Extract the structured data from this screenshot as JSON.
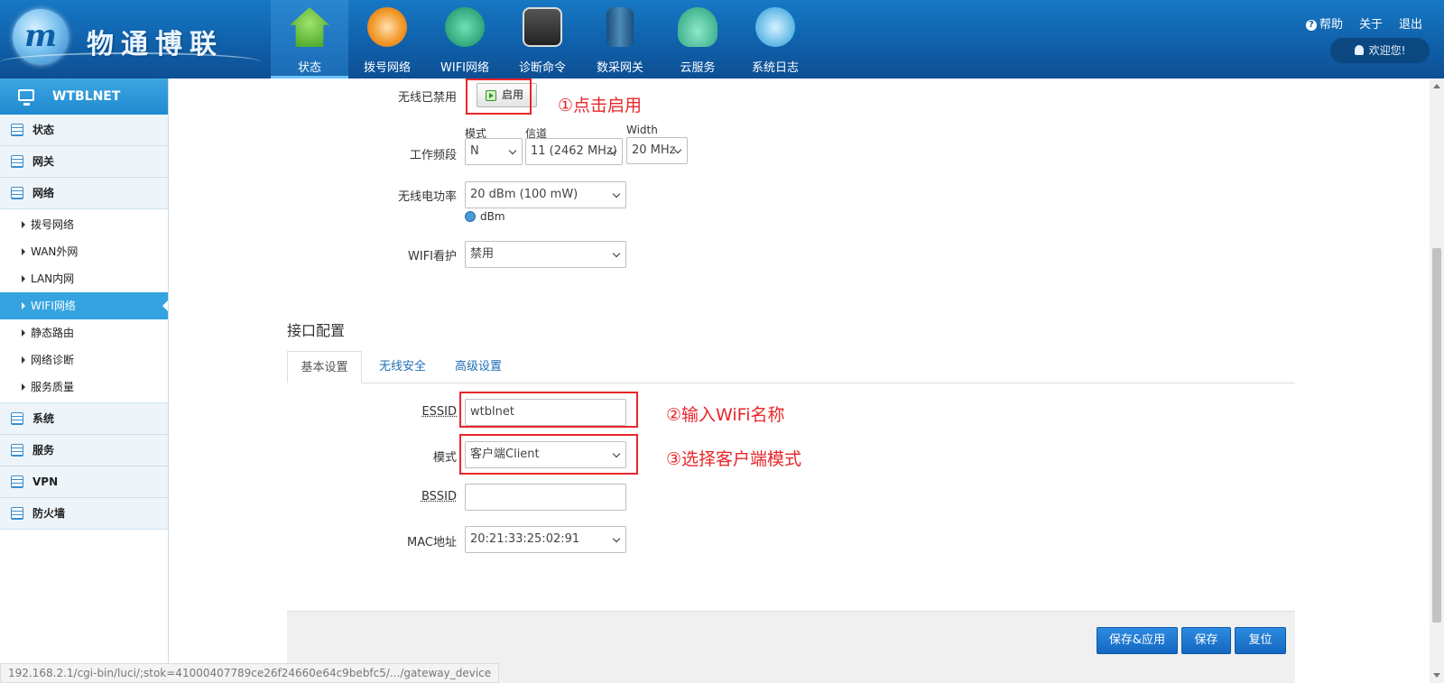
{
  "header": {
    "brand": "物通博联",
    "logo_letter": "m",
    "nav": [
      {
        "label": "状态",
        "icon": "home-icon",
        "active": true
      },
      {
        "label": "拨号网络",
        "icon": "dial-icon",
        "active": false
      },
      {
        "label": "WIFI网络",
        "icon": "wifi-icon",
        "active": false
      },
      {
        "label": "诊断命令",
        "icon": "terminal-icon",
        "active": false
      },
      {
        "label": "数采网关",
        "icon": "gateway-icon",
        "active": false
      },
      {
        "label": "云服务",
        "icon": "cloud-icon",
        "active": false
      },
      {
        "label": "系统日志",
        "icon": "stethoscope-icon",
        "active": false
      }
    ],
    "links": {
      "help": "帮助",
      "about": "关于",
      "logout": "退出"
    },
    "welcome": "欢迎您!"
  },
  "sidebar": {
    "title": "WTBLNET",
    "sections": [
      {
        "label": "状态"
      },
      {
        "label": "网关"
      },
      {
        "label": "网络"
      }
    ],
    "network_items": [
      "拨号网络",
      "WAN外网",
      "LAN内网",
      "WIFI网络",
      "静态路由",
      "网络诊断",
      "服务质量"
    ],
    "active_item": "WIFI网络",
    "sections_after": [
      {
        "label": "系统"
      },
      {
        "label": "服务"
      },
      {
        "label": "VPN"
      },
      {
        "label": "防火墙"
      }
    ]
  },
  "form": {
    "wireless_disabled_label": "无线已禁用",
    "enable_button": "启用",
    "band_label": "工作频段",
    "mode_caption": "模式",
    "channel_caption": "信道",
    "width_caption": "Width",
    "mode_value": "N",
    "channel_value": "11 (2462 MHz)",
    "width_value": "20 MHz",
    "power_label": "无线电功率",
    "power_value": "20 dBm (100 mW)",
    "power_unit": "dBm",
    "watchdog_label": "WIFI看护",
    "watchdog_value": "禁用",
    "interface_title": "接口配置",
    "tabs": [
      "基本设置",
      "无线安全",
      "高级设置"
    ],
    "essid_label": "ESSID",
    "essid_value": "wtblnet",
    "mode_label": "模式",
    "iface_mode_value": "客户端Client",
    "bssid_label": "BSSID",
    "bssid_value": "",
    "mac_label": "MAC地址",
    "mac_value": "20:21:33:25:02:91"
  },
  "annotations": [
    "①点击启用",
    "②输入WiFi名称",
    "③选择客户端模式"
  ],
  "buttons": {
    "save_apply": "保存&应用",
    "save": "保存",
    "reset": "复位"
  },
  "status_url": "192.168.2.1/cgi-bin/luci/;stok=41000407789ce26f24660e64c9bebfc5/.../gateway_device",
  "colors": {
    "header": "#1372bd",
    "accent": "#35a3e0",
    "annotation": "#e8262a",
    "primary_button": "#1f78d1"
  }
}
